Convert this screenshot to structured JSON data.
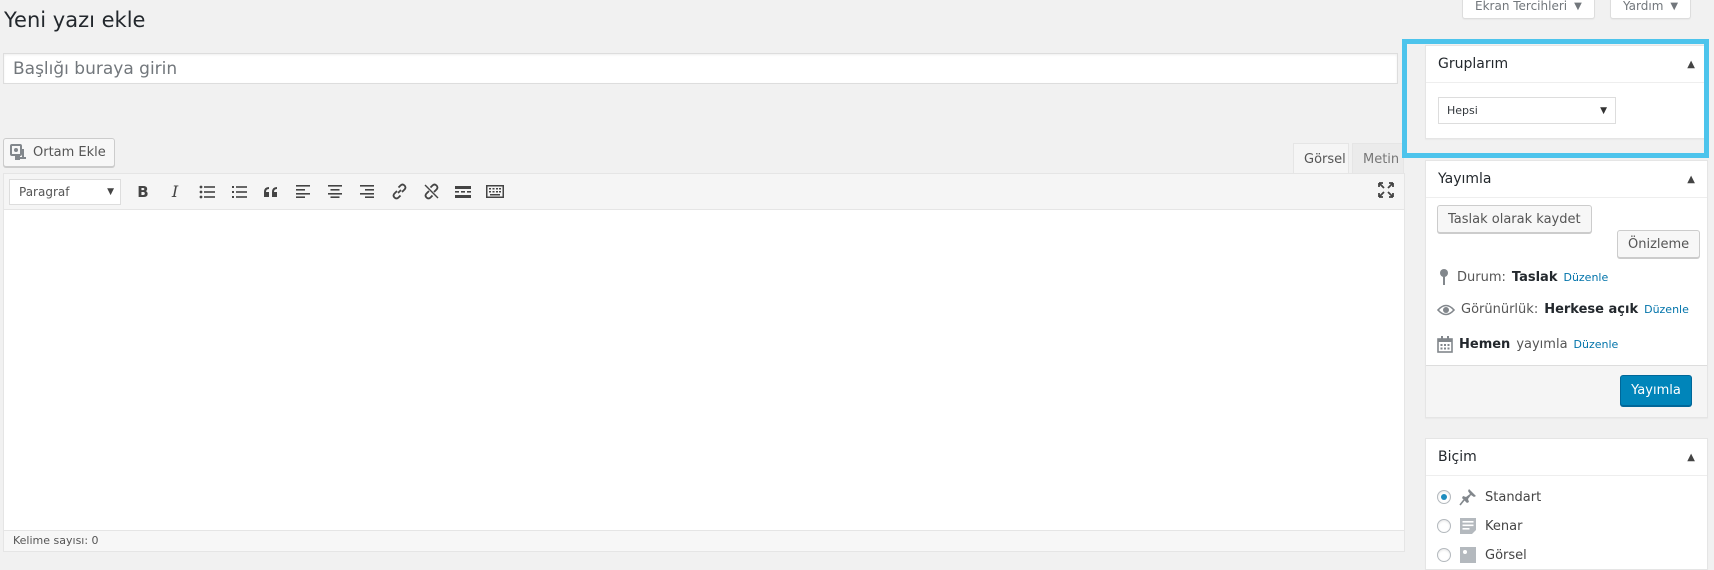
{
  "page": {
    "title": "Yeni yazı ekle"
  },
  "header_tabs": {
    "screen_options": "Ekran Tercihleri",
    "help": "Yardım"
  },
  "title_field": {
    "placeholder": "Başlığı buraya girin"
  },
  "media": {
    "add_media_label": "Ortam Ekle"
  },
  "editor_tabs": {
    "visual": "Görsel",
    "text": "Metin"
  },
  "toolbar": {
    "format_value": "Paragraf",
    "buttons": [
      "bold-icon",
      "italic-icon",
      "bullet-list-icon",
      "numbered-list-icon",
      "blockquote-icon",
      "align-left-icon",
      "align-center-icon",
      "align-right-icon",
      "link-icon",
      "unlink-icon",
      "read-more-icon",
      "toolbar-toggle-icon"
    ],
    "fullscreen_icon": "fullscreen-icon"
  },
  "status": {
    "word_count": "Kelime sayısı: 0"
  },
  "groups_box": {
    "title": "Gruplarım",
    "select_value": "Hepsi"
  },
  "publish_box": {
    "title": "Yayımla",
    "save_draft": "Taslak olarak kaydet",
    "preview": "Önizleme",
    "status_label": "Durum:",
    "status_value": "Taslak",
    "visibility_label": "Görünürlük:",
    "visibility_value": "Herkese açık",
    "schedule_value": "Hemen",
    "schedule_suffix": "yayımla",
    "edit_link": "Düzenle",
    "publish_button": "Yayımla"
  },
  "format_box": {
    "title": "Biçim",
    "options": [
      "Standart",
      "Kenar",
      "Görsel"
    ],
    "selected": "Standart"
  },
  "colors": {
    "highlight": "#4dc4ec",
    "primary": "#0085ba",
    "link": "#0073aa"
  }
}
